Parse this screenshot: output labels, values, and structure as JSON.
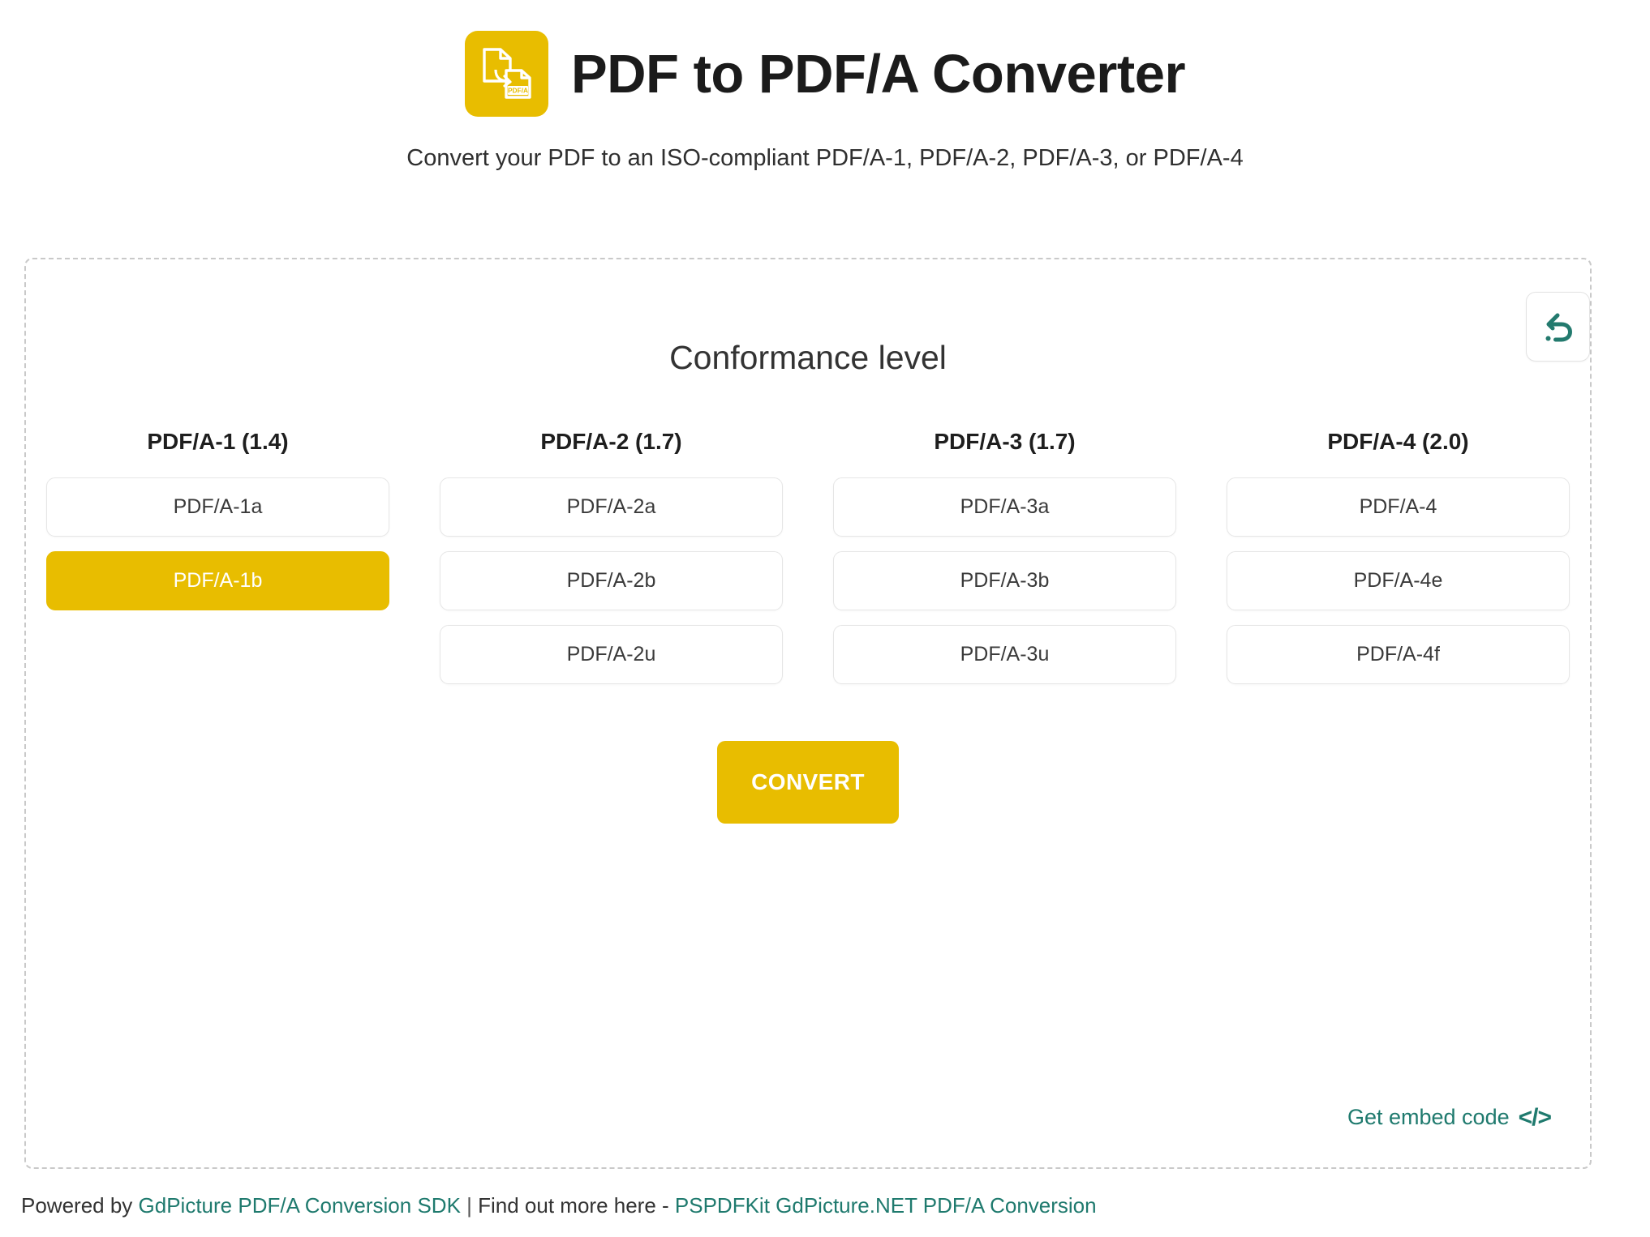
{
  "header": {
    "logo_icon": "pdfa-document-convert-icon",
    "logo_badge_text": "PDF/A",
    "title": "PDF to PDF/A Converter",
    "subtitle": "Convert your PDF to an ISO-compliant PDF/A-1, PDF/A-2, PDF/A-3, or PDF/A-4"
  },
  "panel": {
    "reset_icon": "undo-arrow-icon",
    "section_title": "Conformance level",
    "columns": [
      {
        "header": "PDF/A-1 (1.4)",
        "options": [
          {
            "label": "PDF/A-1a",
            "selected": false
          },
          {
            "label": "PDF/A-1b",
            "selected": true
          }
        ]
      },
      {
        "header": "PDF/A-2 (1.7)",
        "options": [
          {
            "label": "PDF/A-2a",
            "selected": false
          },
          {
            "label": "PDF/A-2b",
            "selected": false
          },
          {
            "label": "PDF/A-2u",
            "selected": false
          }
        ]
      },
      {
        "header": "PDF/A-3 (1.7)",
        "options": [
          {
            "label": "PDF/A-3a",
            "selected": false
          },
          {
            "label": "PDF/A-3b",
            "selected": false
          },
          {
            "label": "PDF/A-3u",
            "selected": false
          }
        ]
      },
      {
        "header": "PDF/A-4 (2.0)",
        "options": [
          {
            "label": "PDF/A-4",
            "selected": false
          },
          {
            "label": "PDF/A-4e",
            "selected": false
          },
          {
            "label": "PDF/A-4f",
            "selected": false
          }
        ]
      }
    ],
    "convert_label": "CONVERT",
    "embed": {
      "label": "Get embed code",
      "icon": "code-brackets-icon",
      "icon_glyph": "</>"
    }
  },
  "footer": {
    "powered_by_prefix": "Powered by ",
    "powered_by_link": "GdPicture PDF/A Conversion SDK",
    "separator": " | ",
    "find_out_text": "Find out more here - ",
    "find_out_link": "PSPDFKit GdPicture.NET PDF/A Conversion"
  },
  "colors": {
    "brand_yellow": "#e8bd00",
    "teal": "#1f7a6e",
    "text_dark": "#1b1b1b",
    "border_light": "#e6e6e6",
    "panel_border": "#c9c9c9"
  }
}
